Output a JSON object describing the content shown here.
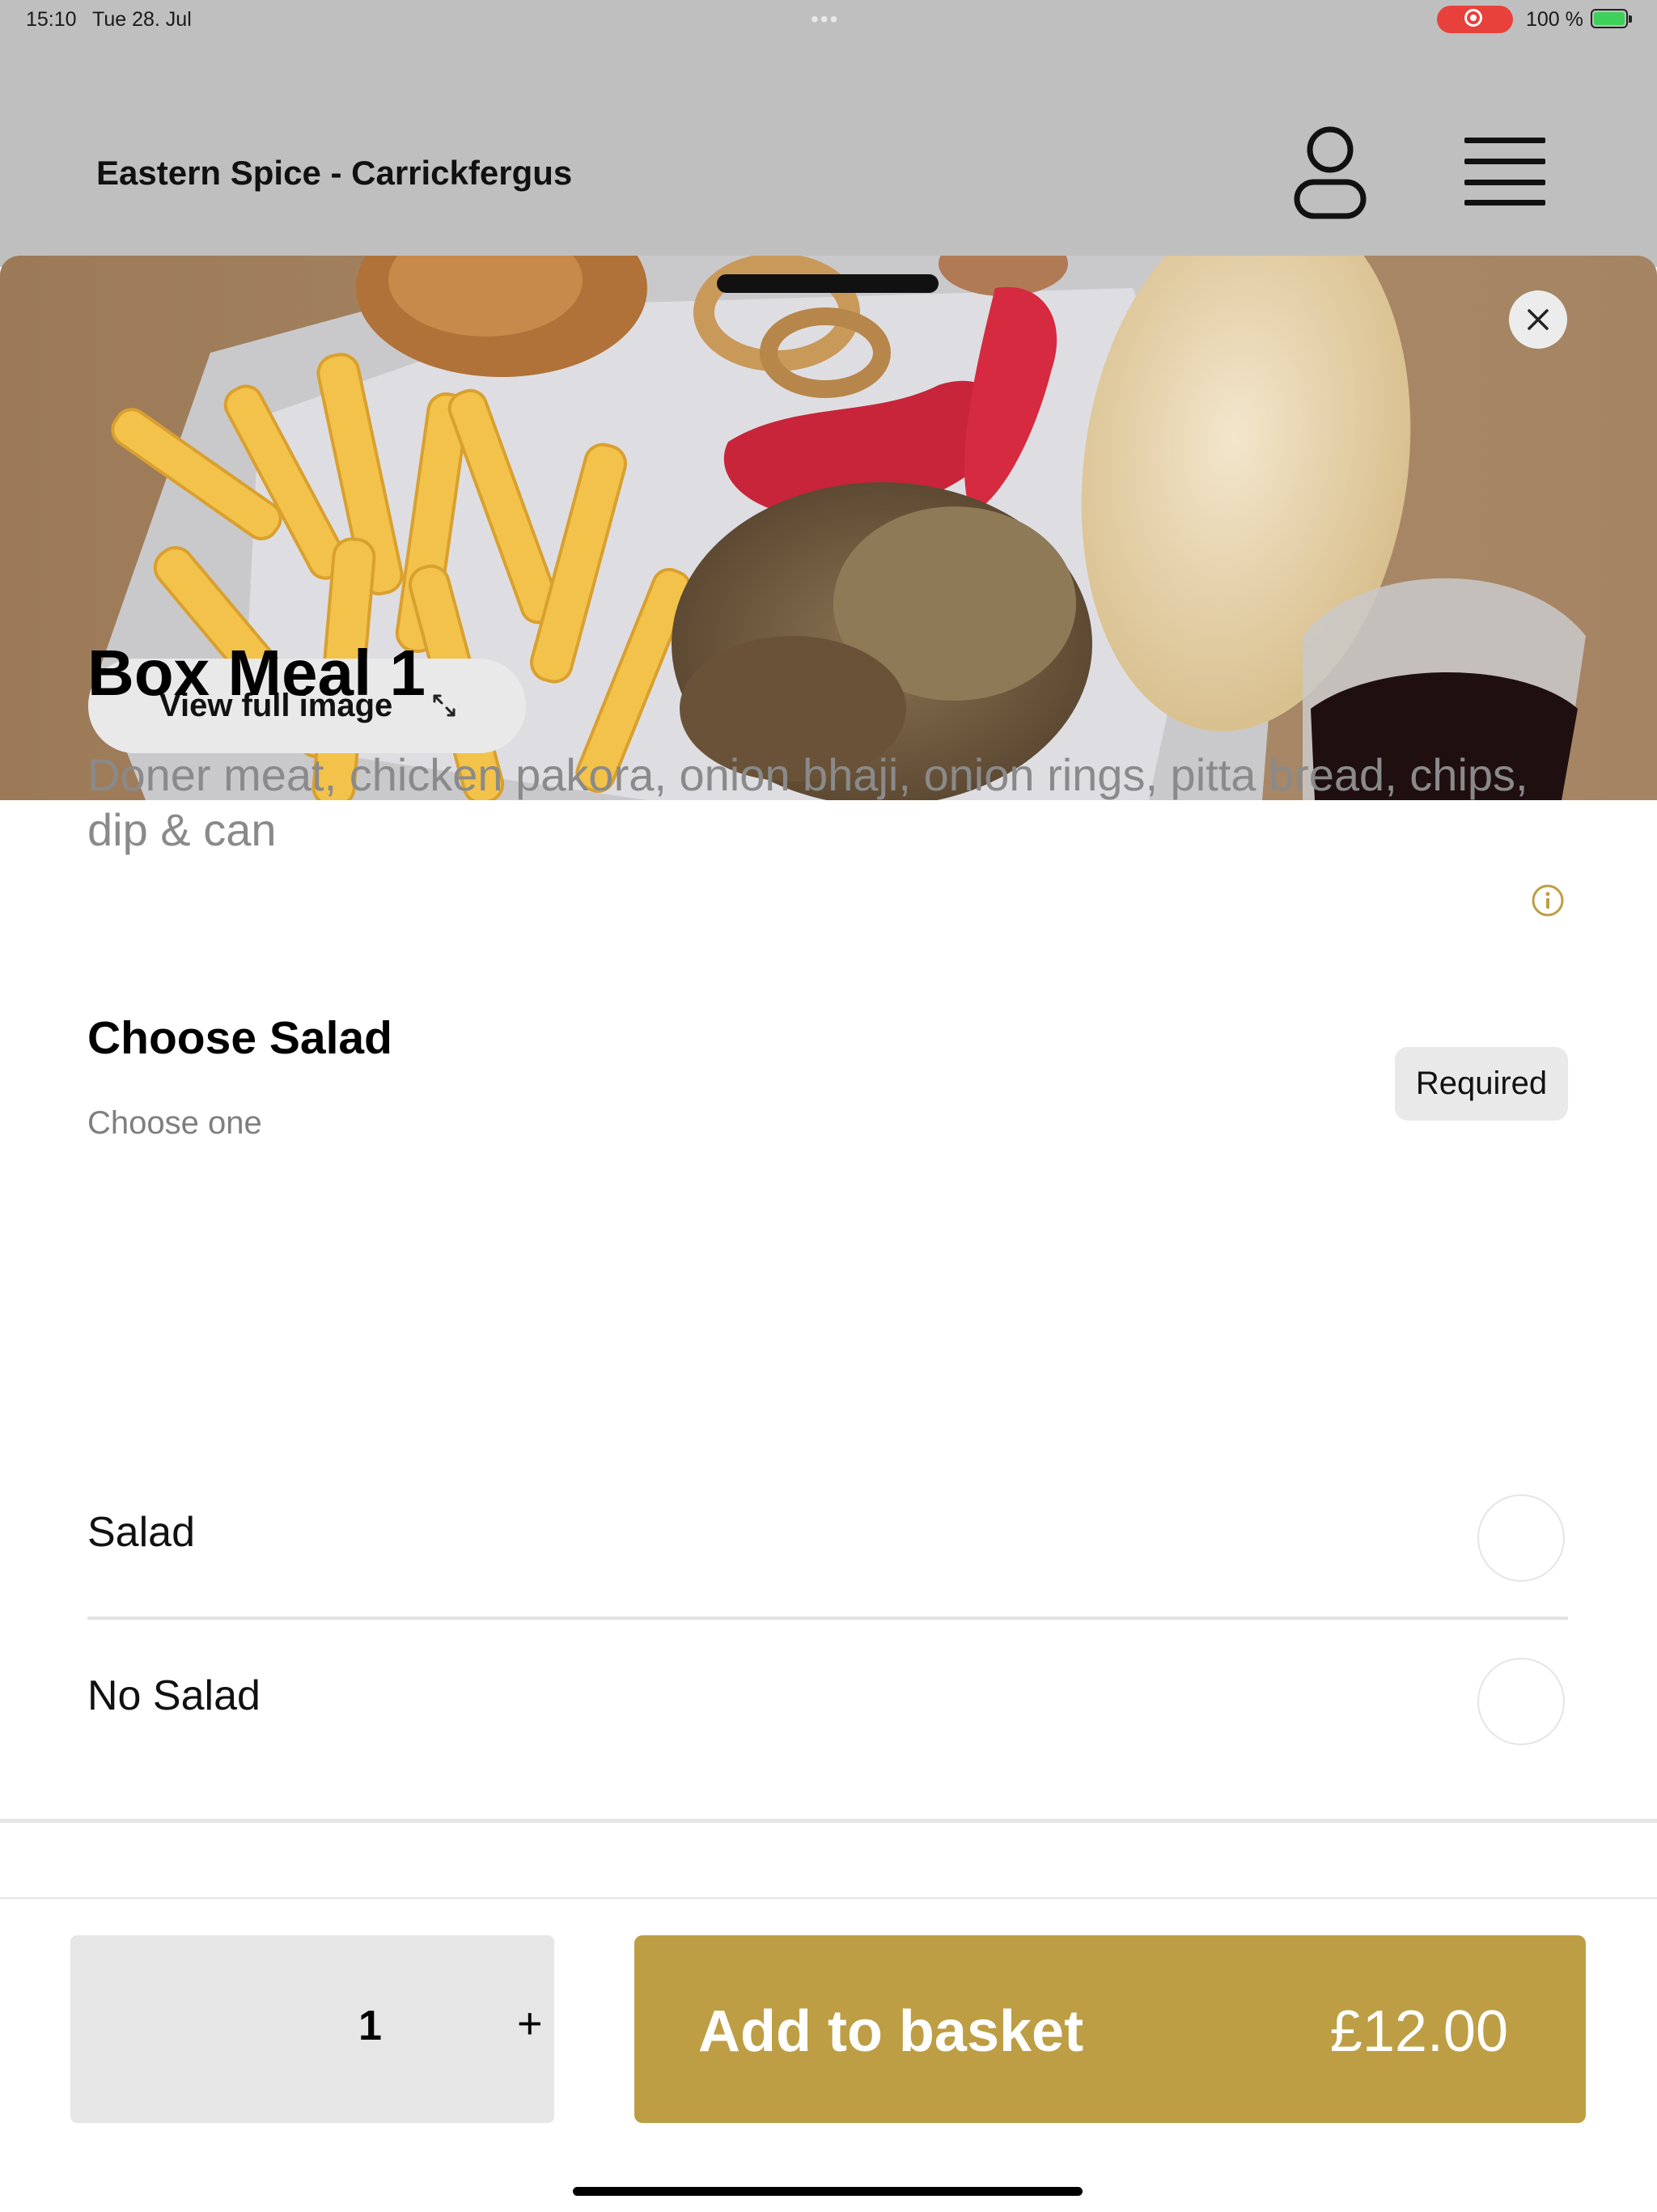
{
  "status_bar": {
    "time": "15:10",
    "date": "Tue 28. Jul",
    "battery": "100 %"
  },
  "header": {
    "title": "Eastern Spice - Carrickfergus",
    "profile_icon": "person-icon",
    "menu_icon": "hamburger-menu-icon"
  },
  "item_modal": {
    "image_alt": "Box meal food photo",
    "view_full_image_label": "View full image",
    "title": "Box Meal 1",
    "description": "Doner meat, chicken pakora, onion bhaji, onion rings, pitta bread, chips, dip & can"
  },
  "option_group": {
    "title": "Choose Salad",
    "subtitle": "Choose one",
    "badge": "Required",
    "options": [
      {
        "label": "Salad",
        "selected": false
      },
      {
        "label": "No Salad",
        "selected": false
      }
    ]
  },
  "footer": {
    "quantity": "1",
    "plus_label": "+",
    "add_label": "Add to basket",
    "price": "£12.00"
  },
  "colors": {
    "accent": "#bd9e44",
    "dim_background": "#bfbfbf",
    "muted_text": "#8a8a8a"
  }
}
